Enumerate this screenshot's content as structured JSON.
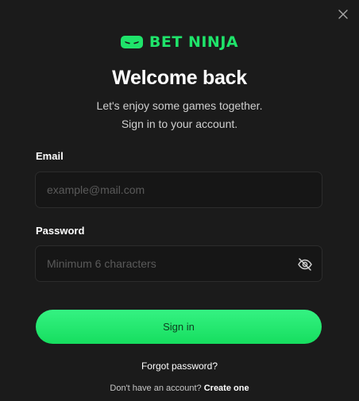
{
  "brand": {
    "logo_text": "BET NINJA",
    "accent_color": "#1fe36a"
  },
  "dialog": {
    "title": "Welcome back",
    "subtitle_line1": "Let's enjoy some games together.",
    "subtitle_line2": "Sign in to your account.",
    "close_icon": "close-icon"
  },
  "form": {
    "email_label": "Email",
    "email_placeholder": "example@mail.com",
    "email_value": "",
    "password_label": "Password",
    "password_placeholder": "Minimum 6 characters",
    "password_value": "",
    "password_toggle_icon": "eye-off-icon",
    "submit_label": "Sign in"
  },
  "footer": {
    "forgot_password": "Forgot password?",
    "signup_prompt": "Don't have an account?",
    "signup_link": "Create one"
  }
}
